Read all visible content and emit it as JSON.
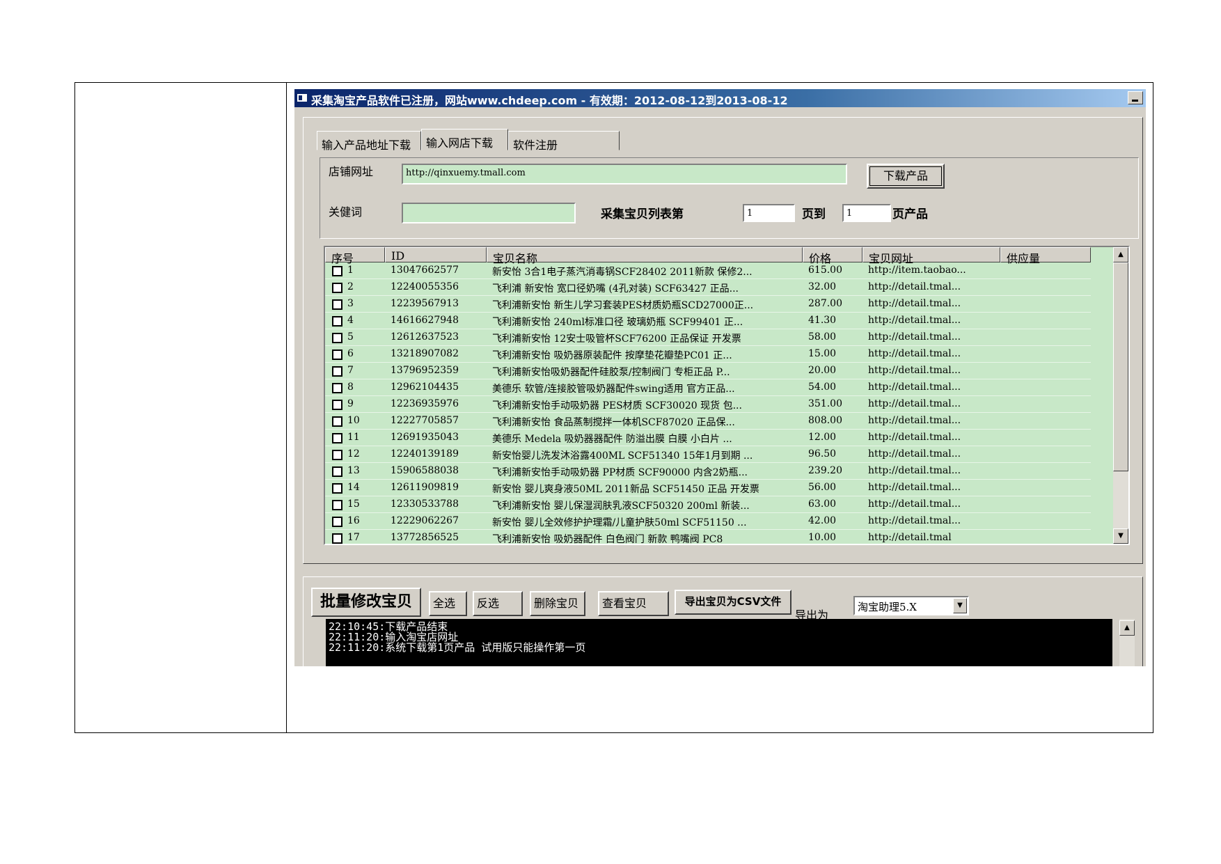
{
  "window": {
    "title": "采集淘宝产品软件已注册，网站www.chdeep.com - 有效期：2012-08-12到2013-08-12"
  },
  "tabs": [
    {
      "label": "输入产品地址下载"
    },
    {
      "label": "输入网店下载"
    },
    {
      "label": "软件注册"
    }
  ],
  "form": {
    "shop_label": "店铺网址",
    "shop_url": "http://qinxuemy.tmall.com",
    "download_button": "下载产品",
    "keyword_label": "关健词",
    "keyword_value": "",
    "collect_label": "采集宝贝列表第",
    "page_from": "1",
    "page_to_label": "页到",
    "page_to": "1",
    "page_suffix_label": "页产品"
  },
  "table": {
    "columns": [
      "序号",
      "ID",
      "宝贝名称",
      "价格",
      "宝贝网址",
      "供应量"
    ],
    "rows": [
      {
        "no": "1",
        "id": "13047662577",
        "name": "新安怡 3合1电子蒸汽消毒锅SCF28402 2011新款 保修2...",
        "price": "615.00",
        "url": "http://item.taobao..."
      },
      {
        "no": "2",
        "id": "12240055356",
        "name": "飞利浦 新安怡 宽口径奶嘴 (4孔对装) SCF63427 正品...",
        "price": "32.00",
        "url": "http://detail.tmal..."
      },
      {
        "no": "3",
        "id": "12239567913",
        "name": "飞利浦新安怡 新生儿学习套装PES材质奶瓶SCD27000正...",
        "price": "287.00",
        "url": "http://detail.tmal..."
      },
      {
        "no": "4",
        "id": "14616627948",
        "name": "飞利浦新安怡 240ml标准口径 玻璃奶瓶 SCF99401 正...",
        "price": "41.30",
        "url": "http://detail.tmal..."
      },
      {
        "no": "5",
        "id": "12612637523",
        "name": "飞利浦新安怡 12安士吸管杯SCF76200 正品保证 开发票",
        "price": "58.00",
        "url": "http://detail.tmal..."
      },
      {
        "no": "6",
        "id": "13218907082",
        "name": "飞利浦新安怡 吸奶器原装配件 按摩垫花瓣垫PC01 正...",
        "price": "15.00",
        "url": "http://detail.tmal..."
      },
      {
        "no": "7",
        "id": "13796952359",
        "name": "飞利浦新安怡吸奶器配件硅胶泵/控制阀门 专柜正品 P...",
        "price": "20.00",
        "url": "http://detail.tmal..."
      },
      {
        "no": "8",
        "id": "12962104435",
        "name": "美德乐 软管/连接胶管吸奶器配件swing适用 官方正品...",
        "price": "54.00",
        "url": "http://detail.tmal..."
      },
      {
        "no": "9",
        "id": "12236935976",
        "name": "飞利浦新安怡手动吸奶器 PES材质 SCF30020 现货 包...",
        "price": "351.00",
        "url": "http://detail.tmal..."
      },
      {
        "no": "10",
        "id": "12227705857",
        "name": "飞利浦新安怡 食品蒸制搅拌一体机SCF87020 正品保...",
        "price": "808.00",
        "url": "http://detail.tmal..."
      },
      {
        "no": "11",
        "id": "12691935043",
        "name": "美德乐 Medela 吸奶器器配件 防溢出膜 白膜 小白片 ...",
        "price": "12.00",
        "url": "http://detail.tmal..."
      },
      {
        "no": "12",
        "id": "12240139189",
        "name": "新安怡婴儿洗发沐浴露400ML SCF51340 15年1月到期 ...",
        "price": "96.50",
        "url": "http://detail.tmal..."
      },
      {
        "no": "13",
        "id": "15906588038",
        "name": "飞利浦新安怡手动吸奶器 PP材质 SCF90000 内含2奶瓶...",
        "price": "239.20",
        "url": "http://detail.tmal..."
      },
      {
        "no": "14",
        "id": "12611909819",
        "name": "新安怡 婴儿爽身液50ML 2011新品 SCF51450 正品 开发票",
        "price": "56.00",
        "url": "http://detail.tmal..."
      },
      {
        "no": "15",
        "id": "12330533788",
        "name": "飞利浦新安怡 婴儿保湿润肤乳液SCF50320 200ml 新装...",
        "price": "63.00",
        "url": "http://detail.tmal..."
      },
      {
        "no": "16",
        "id": "12229062267",
        "name": "新安怡 婴儿全效修护护理霜/儿童护肤50ml SCF51150 ...",
        "price": "42.00",
        "url": "http://detail.tmal..."
      },
      {
        "no": "17",
        "id": "13772856525",
        "name": "飞利浦新安怡 吸奶器配件 白色阀门 新款 鸭嘴阀 PC8",
        "price": "10.00",
        "url": "http://detail.tmal"
      }
    ]
  },
  "actions": {
    "batch_edit": "批量修改宝贝",
    "select_all": "全选",
    "invert": "反选",
    "delete": "删除宝贝",
    "view": "查看宝贝",
    "export_csv": "导出宝贝为CSV文件",
    "export_as_label": "导出为",
    "export_format": "淘宝助理5.X"
  },
  "log": [
    "22:10:45:下载产品结束",
    "22:11:20:输入淘宝店网址",
    "22:11:20:系统下载第1页产品 试用版只能操作第一页"
  ]
}
